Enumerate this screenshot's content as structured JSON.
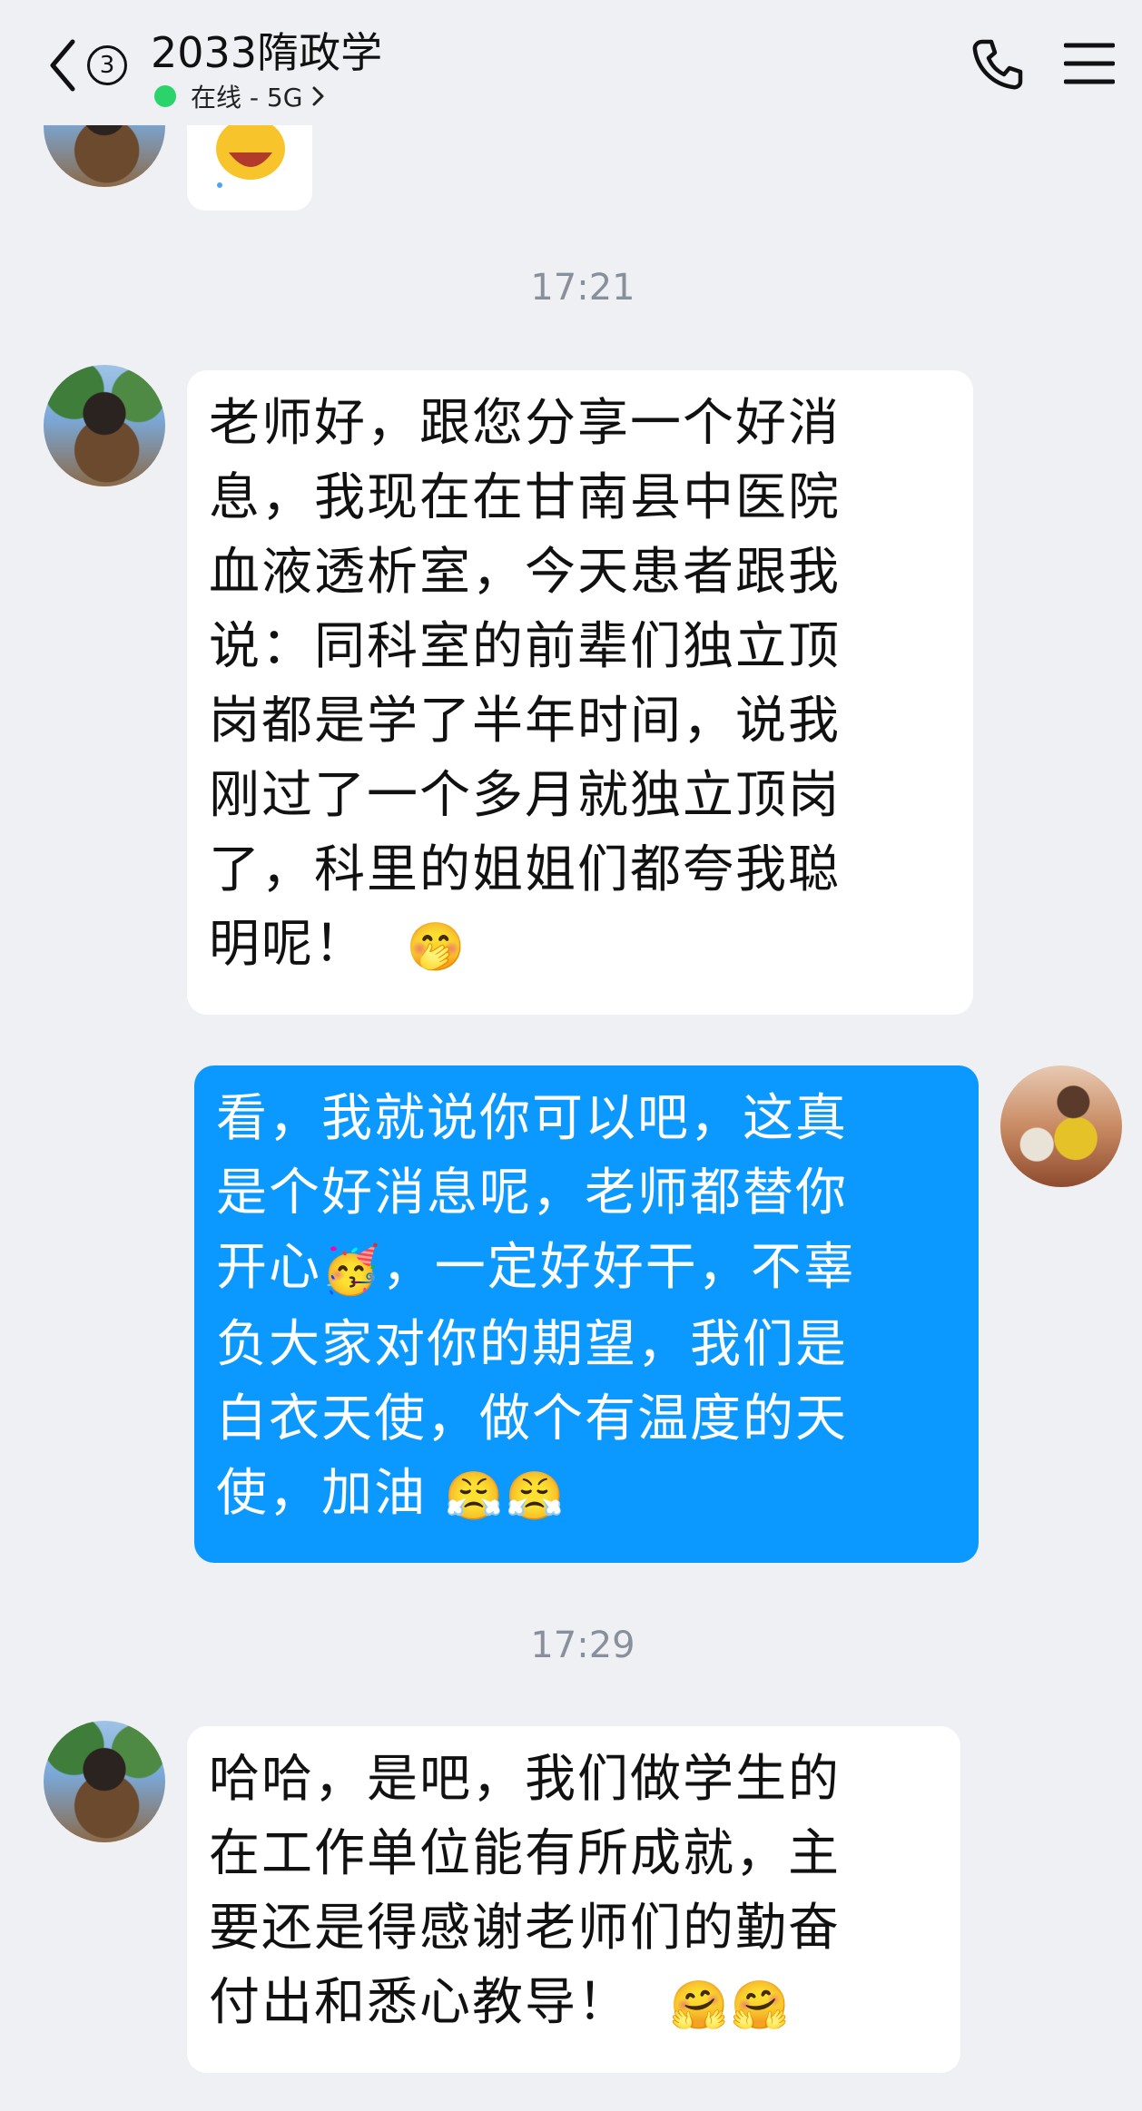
{
  "header": {
    "title": "2033隋政学",
    "unread_count": "3",
    "status": "在线 - 5G",
    "icons": {
      "back": "chevron-left-icon",
      "status_arrow": "chevron-right-icon",
      "call": "phone-icon",
      "menu": "hamburger-menu-icon"
    },
    "status_color": "#2bd46b"
  },
  "messages": [
    {
      "type": "time",
      "text": "17:21"
    },
    {
      "type": "incoming",
      "lines": [
        "老师好，跟您分享一个好消",
        "息，我现在在甘南县中医院",
        "血液透析室，今天患者跟我",
        "说：同科室的前辈们独立顶",
        "岗都是学了半年时间，说我",
        "刚过了一个多月就独立顶岗",
        "了，科里的姐姐们都夸我聪",
        "明呢！"
      ],
      "emoji": "🤭"
    },
    {
      "type": "outgoing",
      "lines": [
        "看，我就说你可以吧，这真",
        "是个好消息呢，老师都替你",
        "开心",
        "，一定好好干，不辜",
        "负大家对你的期望，我们是",
        "白衣天使，做个有温度的天",
        "使，加油"
      ],
      "emoji_party": "🥳",
      "emoji_fight": "😤😤"
    },
    {
      "type": "time",
      "text": "17:29"
    },
    {
      "type": "incoming",
      "lines": [
        "哈哈，是吧，我们做学生的",
        "在工作单位能有所成就，主",
        "要还是得感谢老师们的勤奋",
        "付出和悉心教导！"
      ],
      "emoji": "🤗🤗"
    }
  ],
  "colors": {
    "background": "#eef0f4",
    "incoming_bubble": "#ffffff",
    "outgoing_bubble": "#0b99ff",
    "timestamp": "#8a909b"
  }
}
